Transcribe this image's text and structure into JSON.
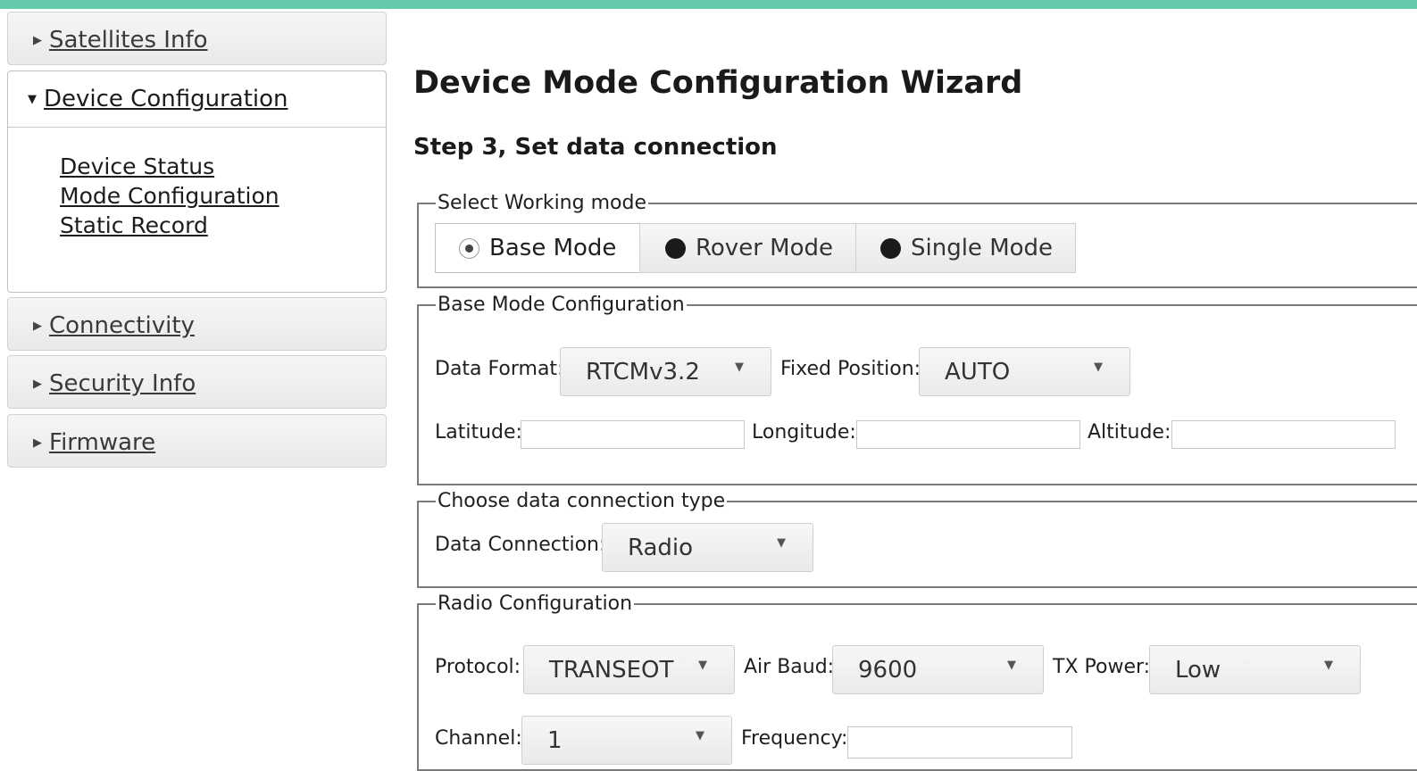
{
  "sidebar": {
    "satellites": "Satellites Info",
    "device_configuration": "Device Configuration",
    "device_status": "Device Status",
    "mode_configuration": "Mode Configuration",
    "static_record": "Static Record",
    "connectivity": "Connectivity",
    "security": "Security Info",
    "firmware": "Firmware"
  },
  "main": {
    "title": "Device Mode Configuration Wizard",
    "step": "Step 3, Set data connection"
  },
  "working_mode": {
    "legend": "Select Working mode",
    "options": [
      "Base Mode",
      "Rover Mode",
      "Single Mode"
    ],
    "selected": "Base Mode"
  },
  "base_config": {
    "legend": "Base Mode Configuration",
    "data_format_label": "Data Format:",
    "data_format_value": "RTCMv3.2",
    "fixed_position_label": "Fixed Position:",
    "fixed_position_value": "AUTO",
    "latitude_label": "Latitude:",
    "longitude_label": "Longitude:",
    "altitude_label": "Altitude:"
  },
  "connection": {
    "legend": "Choose data connection type",
    "label": "Data Connection:",
    "value": "Radio"
  },
  "radio": {
    "legend": "Radio Configuration",
    "protocol_label": "Protocol:",
    "protocol_value": "TRANSEOT",
    "air_baud_label": "Air Baud:",
    "air_baud_value": "9600",
    "tx_power_label": "TX Power:",
    "tx_power_value": "Low",
    "channel_label": "Channel:",
    "channel_value": "1",
    "frequency_label": "Frequency:"
  },
  "colors": {
    "top_bar": "#66c9ad"
  }
}
